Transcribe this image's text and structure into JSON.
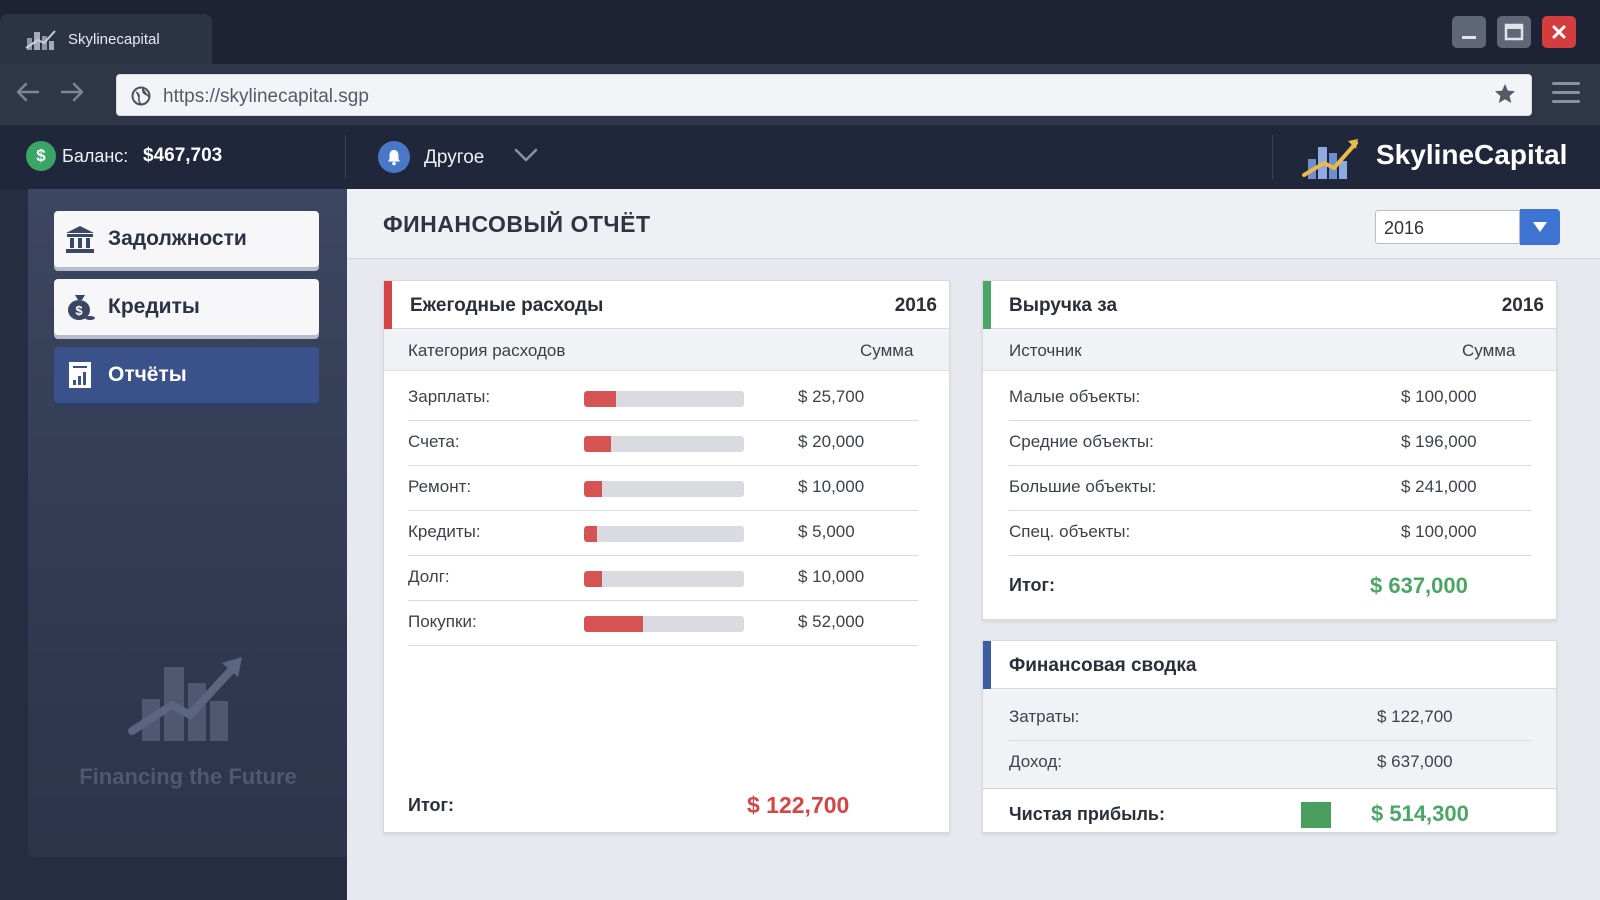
{
  "browser": {
    "tab_title": "Skylinecapital",
    "url": "https://skylinecapital.sgp"
  },
  "appbar": {
    "balance_label": "Баланс:",
    "balance_value": "$467,703",
    "notifications_label": "Другое",
    "brand_name": "SkylineCapital"
  },
  "sidebar": {
    "items": [
      {
        "label": "Задолжности",
        "icon": "bank-icon",
        "active": false
      },
      {
        "label": "Кредиты",
        "icon": "money-bag-icon",
        "active": false
      },
      {
        "label": "Отчёты",
        "icon": "report-icon",
        "active": true
      }
    ],
    "watermark_text": "Financing the Future"
  },
  "main": {
    "title": "ФИНАНСОВЫЙ ОТЧЁТ",
    "year_selected": "2016",
    "expenses": {
      "title": "Ежегодные расходы",
      "year": "2016",
      "col_category": "Категория расходов",
      "col_amount": "Сумма",
      "rows": [
        {
          "label": "Зарплаты:",
          "amount": "$ 25,700",
          "share": 0.2
        },
        {
          "label": "Счета:",
          "amount": "$ 20,000",
          "share": 0.17
        },
        {
          "label": "Ремонт:",
          "amount": "$ 10,000",
          "share": 0.11
        },
        {
          "label": "Кредиты:",
          "amount": "$ 5,000",
          "share": 0.08
        },
        {
          "label": "Долг:",
          "amount": "$ 10,000",
          "share": 0.11
        },
        {
          "label": "Покупки:",
          "amount": "$ 52,000",
          "share": 0.37
        }
      ],
      "total_label": "Итог:",
      "total_value": "$ 122,700"
    },
    "revenue": {
      "title": "Выручка за",
      "year": "2016",
      "col_source": "Источник",
      "col_amount": "Сумма",
      "rows": [
        {
          "label": "Малые объекты:",
          "amount": "$ 100,000"
        },
        {
          "label": "Средние объекты:",
          "amount": "$ 196,000"
        },
        {
          "label": "Большие объекты:",
          "amount": "$ 241,000"
        },
        {
          "label": "Спец. объекты:",
          "amount": "$ 100,000"
        }
      ],
      "total_label": "Итог:",
      "total_value": "$ 637,000"
    },
    "summary": {
      "title": "Финансовая сводка",
      "costs_label": "Затраты:",
      "costs_value": "$ 122,700",
      "income_label": "Доход:",
      "income_value": "$ 637,000",
      "net_label": "Чистая прибыль:",
      "net_value": "$ 514,300"
    }
  },
  "colors": {
    "expense_accent": "#d64545",
    "revenue_accent": "#4aa664",
    "summary_accent": "#3d5fa0",
    "active_nav": "#3a5289"
  }
}
